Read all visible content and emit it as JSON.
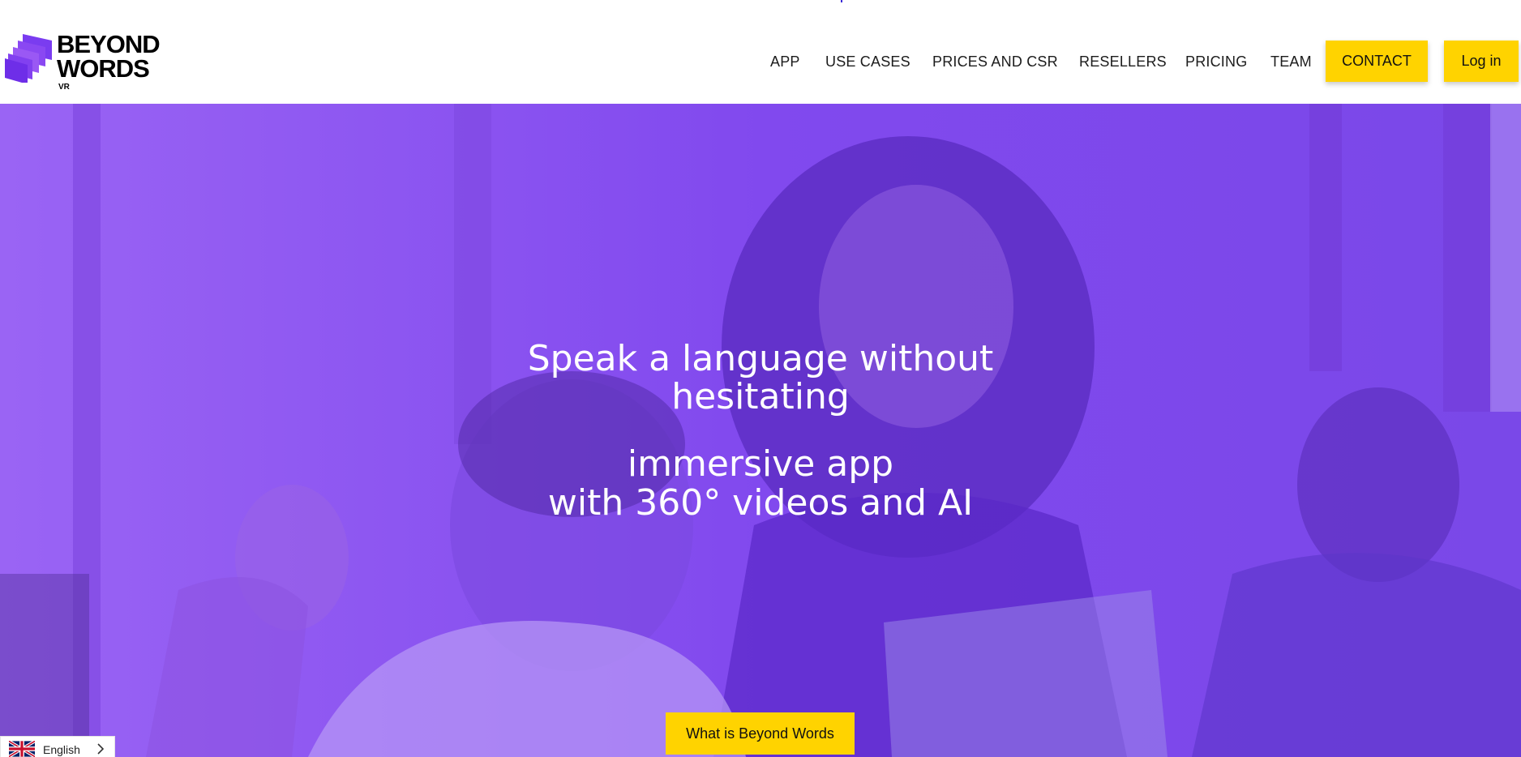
{
  "brand": {
    "name_line1": "BEYOND",
    "name_line2": "WORDS",
    "name": "BEYOND\nWORDS",
    "sub": "VR"
  },
  "nav": {
    "items": [
      {
        "label": "APP"
      },
      {
        "label": "USE CASES"
      },
      {
        "label": "PRICES AND CSR"
      },
      {
        "label": "RESELLERS"
      },
      {
        "label": "PRICING"
      },
      {
        "label": "TEAM"
      }
    ],
    "contact_label": "CONTACT",
    "login_label": "Log in"
  },
  "hero": {
    "title_line1": "Speak a language without",
    "title_line2": "hesitating",
    "sub_line1": "immersive app",
    "sub_line2": "with 360° videos and AI",
    "cta_label": "What is Beyond Words"
  },
  "language": {
    "label": "English",
    "flag": "uk-flag-icon"
  },
  "colors": {
    "accent": "#ffd300",
    "hero_overlay": "#8a4ef0",
    "brand_purple": "#8a3ff0"
  }
}
